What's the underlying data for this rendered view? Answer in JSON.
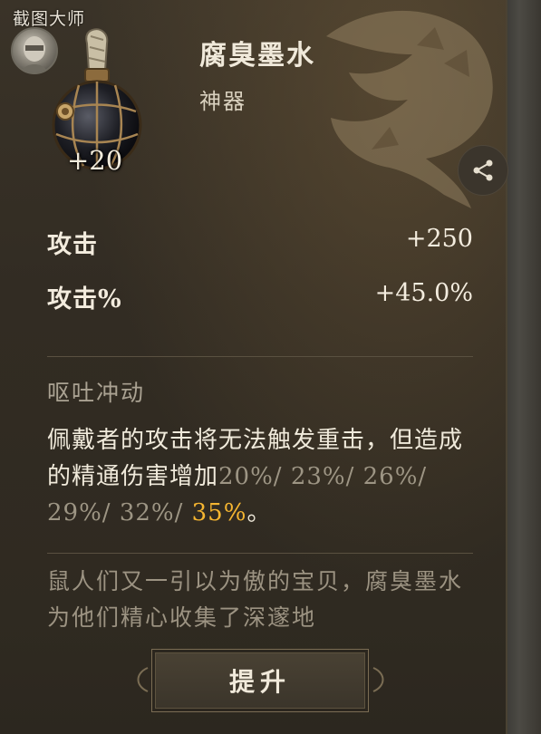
{
  "watermark": "截图大师",
  "item": {
    "name": "腐臭墨水",
    "rarity": "神器",
    "level": "+20"
  },
  "stats": [
    {
      "label": "攻击",
      "value": "+250"
    },
    {
      "label": "攻击%",
      "value": "+45.0%"
    }
  ],
  "passive": {
    "name": "呕吐冲动",
    "desc_main": "佩戴者的攻击将无法触发重击，但造成的精通伤害增加",
    "tiers_dim": "20%/ 23%/ 26%/ 29%/ 32%/ ",
    "tier_current": "35%",
    "end": "。"
  },
  "lore": "鼠人们又一引以为傲的宝贝，腐臭墨水为他们精心收集了深邃地",
  "buttons": {
    "upgrade": "提升"
  },
  "icons": {
    "share": "share-icon",
    "avatar": "player-avatar",
    "item": "ink-flask-icon"
  },
  "colors": {
    "highlight": "#f5b531",
    "dim_text": "#9d9584",
    "main_text": "#f0eadb"
  }
}
